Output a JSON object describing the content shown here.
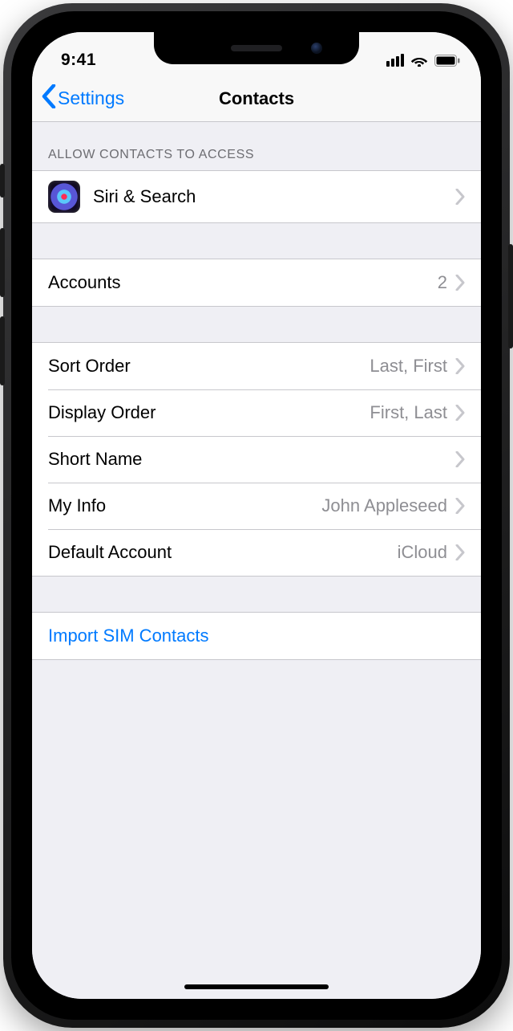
{
  "status": {
    "time": "9:41"
  },
  "nav": {
    "back": "Settings",
    "title": "Contacts"
  },
  "section_allow_header": "ALLOW CONTACTS TO ACCESS",
  "rows": {
    "siri": {
      "label": "Siri & Search"
    },
    "accounts": {
      "label": "Accounts",
      "value": "2"
    },
    "sort_order": {
      "label": "Sort Order",
      "value": "Last, First"
    },
    "display_order": {
      "label": "Display Order",
      "value": "First, Last"
    },
    "short_name": {
      "label": "Short Name"
    },
    "my_info": {
      "label": "My Info",
      "value": "John Appleseed"
    },
    "default_account": {
      "label": "Default Account",
      "value": "iCloud"
    },
    "import_sim": {
      "label": "Import SIM Contacts"
    }
  },
  "colors": {
    "link": "#007aff",
    "secondary": "#8e8e93",
    "separator": "#c7c7cc",
    "bg": "#efeff4"
  }
}
